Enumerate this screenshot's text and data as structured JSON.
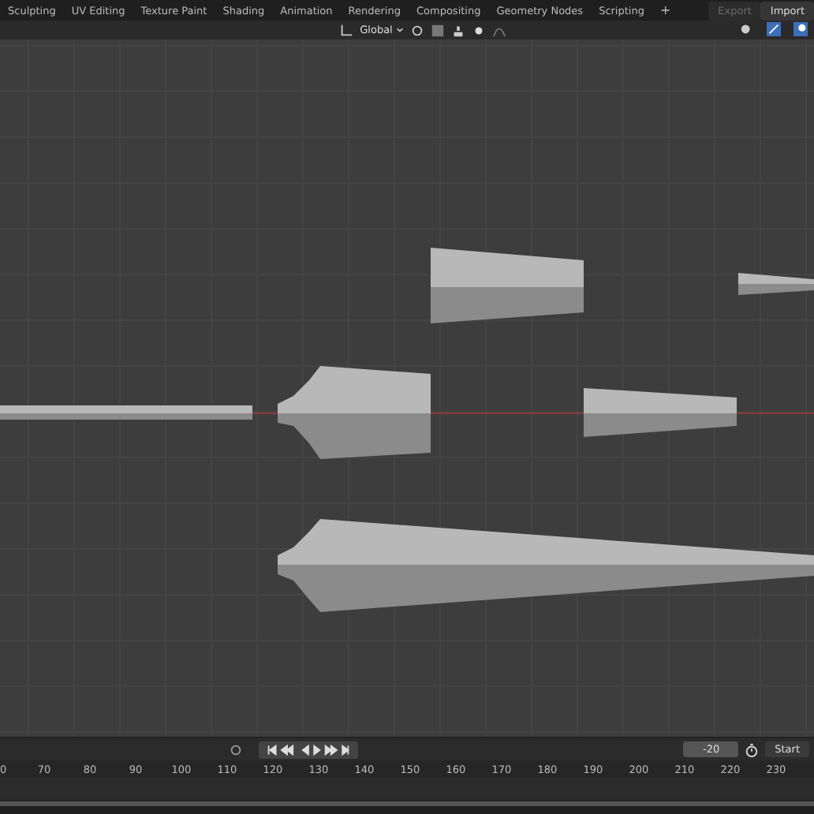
{
  "workspace_tabs": [
    "Sculpting",
    "UV Editing",
    "Texture Paint",
    "Shading",
    "Animation",
    "Rendering",
    "Compositing",
    "Geometry Nodes",
    "Scripting"
  ],
  "add_workspace": "+",
  "io_buttons": [
    {
      "label": "Export",
      "disabled": true
    },
    {
      "label": "Import",
      "disabled": false
    }
  ],
  "header": {
    "orientation": "Global"
  },
  "timeline": {
    "current_frame": "-20",
    "start_label": "Start",
    "ruler": [
      "0",
      "70",
      "80",
      "90",
      "100",
      "110",
      "120",
      "130",
      "140",
      "150",
      "160",
      "170",
      "180",
      "190",
      "200",
      "210",
      "220",
      "230"
    ]
  }
}
